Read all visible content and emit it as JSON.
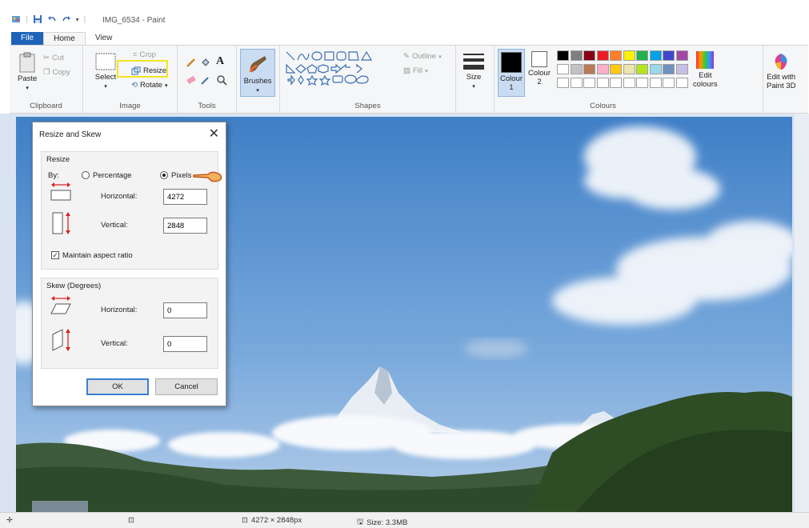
{
  "window": {
    "title": "IMG_6534 - Paint"
  },
  "tabs": {
    "file": "File",
    "home": "Home",
    "view": "View"
  },
  "ribbon": {
    "clipboard": {
      "paste": "Paste",
      "cut": "Cut",
      "copy": "Copy",
      "label": "Clipboard"
    },
    "image": {
      "select": "Select",
      "crop": "Crop",
      "resize": "Resize",
      "rotate": "Rotate",
      "label": "Image"
    },
    "tools": {
      "label": "Tools"
    },
    "brushes": {
      "label": "Brushes"
    },
    "shapes": {
      "outline": "Outline",
      "fill": "Fill",
      "label": "Shapes"
    },
    "size": {
      "label": "Size"
    },
    "colours": {
      "colour1": "Colour",
      "colour1_num": "1",
      "colour2": "Colour",
      "colour2_num": "2",
      "edit": "Edit",
      "edit2": "colours",
      "paint3d": "Edit with",
      "paint3d2": "Paint 3D",
      "label": "Colours",
      "palette_row1": [
        "#000000",
        "#7f7f7f",
        "#880015",
        "#ed1c24",
        "#ff7f27",
        "#fff200",
        "#22b14c",
        "#00a2e8",
        "#3f48cc",
        "#a349a4"
      ],
      "palette_row2": [
        "#ffffff",
        "#c3c3c3",
        "#b97a57",
        "#ffaec9",
        "#ffc90e",
        "#efe4b0",
        "#b5e61d",
        "#99d9ea",
        "#7092be",
        "#c8bfe7"
      ],
      "colour1_value": "#000000",
      "colour2_value": "#ffffff"
    }
  },
  "dialog": {
    "title": "Resize and Skew",
    "resize_section": "Resize",
    "by_label": "By:",
    "percentage_label": "Percentage",
    "pixels_label": "Pixels",
    "selected_mode": "Pixels",
    "horizontal_label": "Horizontal:",
    "horizontal_value": "4272",
    "vertical_label": "Vertical:",
    "vertical_value": "2848",
    "maintain_label": "Maintain aspect ratio",
    "maintain_checked": true,
    "skew_section": "Skew (Degrees)",
    "skew_horizontal_label": "Horizontal:",
    "skew_horizontal_value": "0",
    "skew_vertical_label": "Vertical:",
    "skew_vertical_value": "0",
    "ok": "OK",
    "cancel": "Cancel"
  },
  "statusbar": {
    "dimensions": "4272 × 2848px",
    "size": "Size: 3.3MB"
  }
}
